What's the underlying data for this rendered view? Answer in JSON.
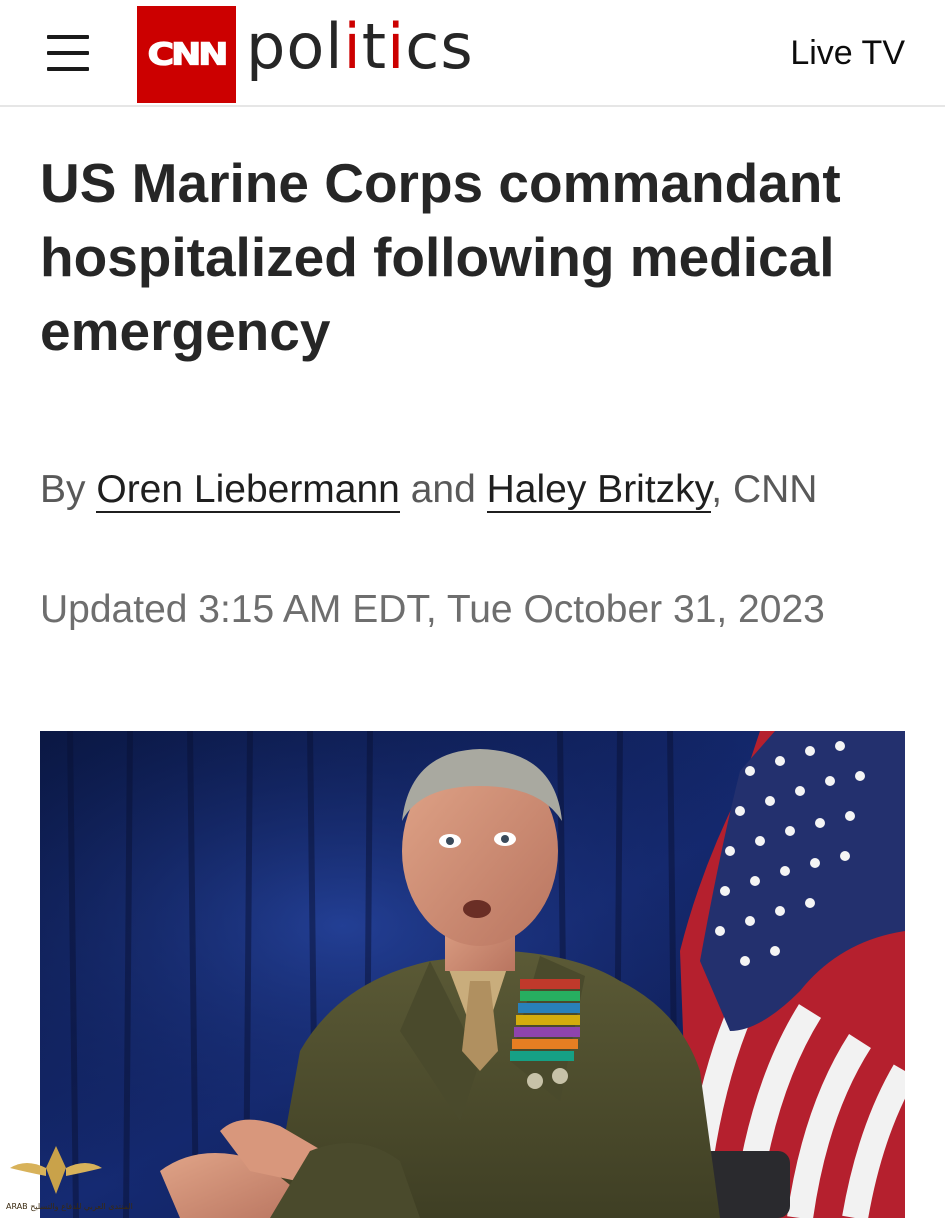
{
  "header": {
    "menu_icon": "hamburger-menu-icon",
    "logo_text": "CNN",
    "section_prefix": "pol",
    "section_accent": "i",
    "section_middle": "t",
    "section_accent2": "i",
    "section_suffix": "cs",
    "live_tv_label": "Live TV",
    "brand_color": "#cc0000"
  },
  "article": {
    "headline": "US Marine Corps commandant hospitalized following medical emergency",
    "byline_prefix": "By",
    "author_1": "Oren Liebermann",
    "byline_and": "and",
    "author_2": "Haley Britzky",
    "byline_suffix": ", CNN",
    "timestamp": "Updated 3:15 AM EDT, Tue October 31, 2023"
  },
  "hero_image": {
    "subject": "photo-of-uniformed-marine-officer-with-us-flag"
  },
  "watermark": {
    "icon": "winged-emblem-icon",
    "text": "ARAB المنتدى العربي للدفاع والتسليح"
  }
}
